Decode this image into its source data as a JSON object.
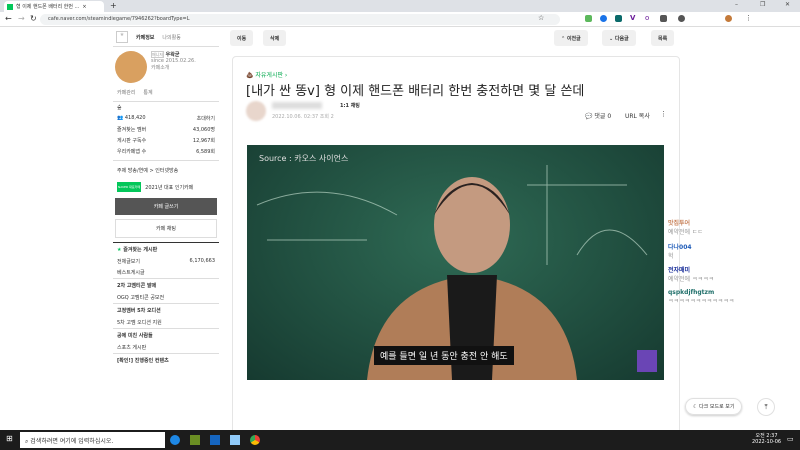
{
  "browser": {
    "tab_title": "형 이제 핸드폰 배터리 한번 ...",
    "url": "cafe.naver.com/steamindiegame/7946262?boardType=L"
  },
  "sidebar": {
    "tabs": [
      "카페정보",
      "나의활동"
    ],
    "manager_badge": "매니저",
    "manager": "우왁굳",
    "since": "since 2015.02.26.",
    "cafe_intro": "카페소개",
    "admin": "카페관리",
    "stats": "통계",
    "level": "숲",
    "members": "418,420",
    "invite": "초대하기",
    "rows": [
      {
        "label": "즐겨찾는 멤버",
        "value": "43,060명"
      },
      {
        "label": "게시판 구독수",
        "value": "12,967회"
      },
      {
        "label": "우리카페앱 수",
        "value": "6,589회"
      }
    ],
    "topic": "주제 방송/연예 > 인터넷방송",
    "award": "2021년 대표 인기카페",
    "naver_badge": "NAVER 대표카페",
    "write": "카페 글쓰기",
    "chat": "카페 채팅",
    "fav_boards": "즐겨찾는 게시판",
    "boards": [
      {
        "type": "item",
        "label": "전체글보기",
        "count": "6,170,663"
      },
      {
        "type": "item",
        "label": "베스트게시글"
      },
      {
        "type": "head",
        "label": "2차 고멤티콘 발매"
      },
      {
        "type": "item",
        "label": "OGQ 고멤티콘 공모전",
        "new": true
      },
      {
        "type": "head",
        "label": "고정멤버 5차 오디션"
      },
      {
        "type": "item",
        "label": "5차 고멤 오디션 지원",
        "new": true
      },
      {
        "type": "head",
        "label": "공에 미친 사람들"
      },
      {
        "type": "item",
        "label": "스포츠 게시판",
        "new": true
      },
      {
        "type": "head",
        "label": "[확인!] 진행중인 컨텐츠",
        "new": true
      }
    ]
  },
  "toolbar": {
    "move": "이동",
    "delete": "삭제",
    "prev": "이전글",
    "next": "다음글",
    "list": "목록"
  },
  "article": {
    "board": "자유게시판",
    "title": "[내가 싼 똥v] 형 이제 핸드폰 배터리 한번 충전하면 몇 달 쓴데",
    "author_chat": "1:1 채팅",
    "meta": "2022.10.06. 02:37 조회 2",
    "comments": "댓글 0",
    "url_copy": "URL 복사",
    "video_source": "Source : 카오스 사이언스",
    "video_caption": "예를 들면 일 년 동안 충전 안 해도"
  },
  "chat": [
    {
      "name": "맛집투어",
      "msg": "예약전에 ㄷㄷ",
      "color": "#c8825a"
    },
    {
      "name": "다나004",
      "msg": "헉",
      "color": "#1e5bb8"
    },
    {
      "name": "전자매미",
      "msg": "예약전에 ㅋㅋㅋㅋ",
      "color": "#1a2f9a"
    },
    {
      "name": "qspkdjfhgtzm",
      "msg": "ㅋㅋㅋㅋㅋㅋㅋㅋㅋㅋㅋㅋ",
      "color": "#1f6f6a"
    }
  ],
  "floating": {
    "dark_mode": "다크 모드로 보기"
  },
  "taskbar": {
    "search": "검색하려면 여기에 입력하십시오.",
    "time": "오전 2:37",
    "date": "2022-10-06"
  }
}
